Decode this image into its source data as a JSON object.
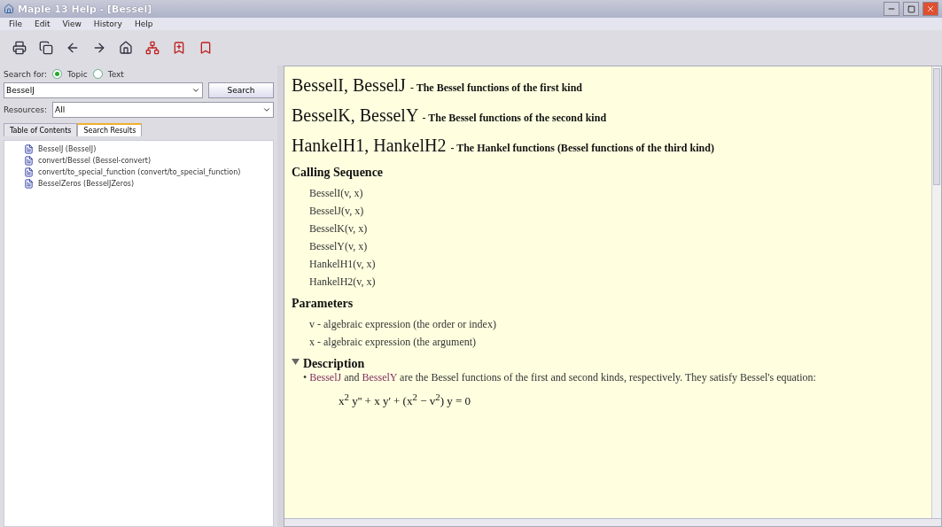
{
  "window": {
    "title": "Maple 13 Help - [Bessel]"
  },
  "menu": [
    "File",
    "Edit",
    "View",
    "History",
    "Help"
  ],
  "search": {
    "label": "Search for:",
    "modes": [
      {
        "label": "Topic",
        "selected": true
      },
      {
        "label": "Text",
        "selected": false
      }
    ],
    "value": "BesselJ",
    "button": "Search",
    "resources_label": "Resources:",
    "resources_value": "All"
  },
  "tabs": [
    {
      "label": "Table of Contents",
      "selected": false
    },
    {
      "label": "Search Results",
      "selected": true
    }
  ],
  "results": [
    {
      "label": "BesselJ (BesselJ)"
    },
    {
      "label": "convert/Bessel (Bessel-convert)"
    },
    {
      "label": "convert/to_special_function (convert/to_special_function)"
    },
    {
      "label": "BesselZeros (BesselJZeros)"
    }
  ],
  "page": {
    "headings": [
      {
        "names": "BesselI, BesselJ",
        "desc": "- The Bessel functions of the first kind"
      },
      {
        "names": "BesselK, BesselY",
        "desc": "- The Bessel functions of the second kind"
      },
      {
        "names": "HankelH1, HankelH2",
        "desc": "- The Hankel functions (Bessel functions of the third kind)"
      }
    ],
    "calling_title": "Calling Sequence",
    "calling": [
      "BesselI(v, x)",
      "BesselJ(v, x)",
      "BesselK(v, x)",
      "BesselY(v, x)",
      "HankelH1(v, x)",
      "HankelH2(v, x)"
    ],
    "params_title": "Parameters",
    "params": [
      {
        "name": "v",
        "text": "- algebraic expression (the order or index)"
      },
      {
        "name": "x",
        "text": "- algebraic expression (the argument)"
      }
    ],
    "description": {
      "title": "Description",
      "expanded": true,
      "bullet": "•",
      "links": [
        "BesselJ",
        "BesselY"
      ],
      "joiner": "and",
      "text": "are the Bessel functions of the first and second kinds, respectively. They satisfy Bessel's equation:",
      "equation": "x$^{2}$ y'' + x y' + (x$^{2}$ − v$^{2}$) y = 0"
    }
  }
}
